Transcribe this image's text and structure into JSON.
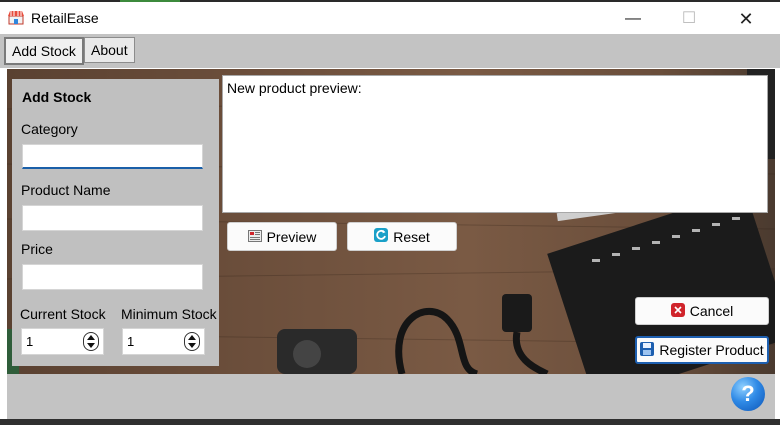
{
  "window": {
    "title": "RetailEase",
    "controls": {
      "minimize": "—",
      "maximize": "☐",
      "close": "✕"
    }
  },
  "tabs": [
    {
      "label": "Add Stock",
      "active": true
    },
    {
      "label": "About",
      "active": false
    }
  ],
  "form": {
    "title": "Add Stock",
    "category_label": "Category",
    "category_value": "",
    "product_name_label": "Product Name",
    "product_name_value": "",
    "price_label": "Price",
    "price_value": "",
    "current_stock_label": "Current Stock",
    "current_stock_value": "1",
    "minimum_stock_label": "Minimum Stock",
    "minimum_stock_value": "1"
  },
  "preview": {
    "text": "New product preview:",
    "preview_button": "Preview",
    "reset_button": "Reset"
  },
  "actions": {
    "cancel_button": "Cancel",
    "register_button": "Register Product",
    "help_button": "?"
  },
  "colors": {
    "panel_bg": "#c0c0c0",
    "accent_blue": "#1d5fb0",
    "cancel_red": "#d0242b"
  }
}
